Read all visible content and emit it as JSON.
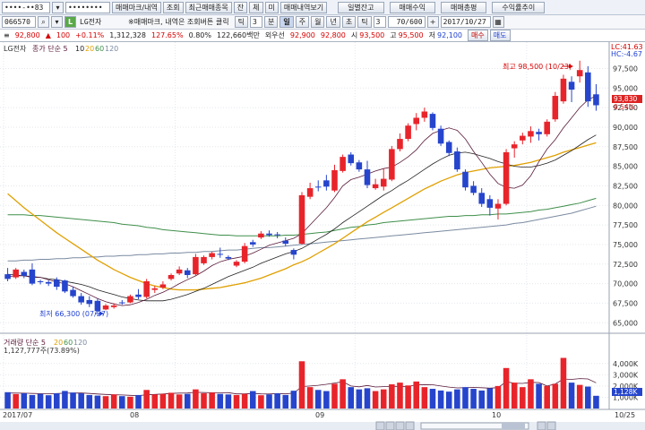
{
  "toolbar1": {
    "account_id": "••••-••83",
    "password_mask": "••••••••",
    "btn_order_history": "매매마크/내역",
    "btn_inquiry": "조회",
    "btn_recent_items": "최근매매종목",
    "btn_jan": "잔",
    "btn_che": "체",
    "btn_mi": "미",
    "btn_trade_history_view": "매매내역보기",
    "btn_daily_balance": "일별잔고",
    "btn_trade_return": "매매수익",
    "btn_trade_amount": "매매총평",
    "btn_return_trend": "수익률추이"
  },
  "toolbar2": {
    "stock_code": "066570",
    "stock_name": "LG전자",
    "notice": "※매매마크, 내역은 조회버튼 클릭",
    "period_tabs": [
      "틱",
      "분",
      "일",
      "주",
      "월",
      "년",
      "초",
      "틱"
    ],
    "active_tab": "일",
    "minute_value": "3",
    "count_value": "3",
    "count_range": "70/600",
    "date_value": "2017/10/27"
  },
  "infobar": {
    "price": "92,800",
    "change": "100",
    "change_pct": "+0.11%",
    "volume": "1,312,328",
    "vol_ratio": "127.65%",
    "turnover": "0.80%",
    "trade_value": "122,660백만",
    "foreign_label": "외우선",
    "ask1": "92,900",
    "bid1": "92,800",
    "open_label": "시",
    "open": "93,500",
    "high_label": "고",
    "high": "95,500",
    "low_label": "저",
    "low": "92,100",
    "buy_button": "매수",
    "sell_button": "매도"
  },
  "price_panel": {
    "legend_title": "LG전자",
    "legend_ma": "종가 단순 5",
    "ma_periods": [
      "10",
      "20",
      "60",
      "120"
    ],
    "lc_label": "LC:41.63",
    "hc_label": "HC:-4.67",
    "high_annotation": "최고 98,500 (10/23)",
    "low_annotation": "최저 66,300 (07/27)",
    "current_price_box": "93,830",
    "current_pct_box": "0.54%"
  },
  "volume_panel": {
    "legend_title": "거래량 단순 5",
    "ma_periods": [
      "20",
      "60",
      "120"
    ],
    "legend_value": "1,127,777주(73.89%)",
    "current_box": "1,128K"
  },
  "x_axis": {
    "labels": [
      "2017/07",
      "08",
      "09",
      "10",
      "10/25"
    ]
  },
  "colors": {
    "up": "#e8242b",
    "down": "#2645cc",
    "ma5": "#5a1a3a",
    "ma10": "#222222",
    "ma20": "#e0a000",
    "ma60": "#3f8f4a",
    "ma120": "#7a8aa0"
  },
  "chart_data": {
    "type": "candlestick",
    "price_ticks": [
      "97,500",
      "95,000",
      "92,500",
      "90,000",
      "87,500",
      "85,000",
      "82,500",
      "80,000",
      "77,500",
      "75,000",
      "72,500",
      "70,000",
      "67,500",
      "65,000"
    ],
    "volume_ticks": [
      "4,000K",
      "3,000K",
      "2,000K",
      "1,000K"
    ],
    "price_range": [
      64000,
      99500
    ],
    "volume_range": [
      0,
      4700
    ],
    "candles": [
      {
        "o": 71200,
        "h": 72000,
        "l": 70300,
        "c": 70600
      },
      {
        "o": 70800,
        "h": 72000,
        "l": 70600,
        "c": 71800
      },
      {
        "o": 71500,
        "h": 71800,
        "l": 70700,
        "c": 71000
      },
      {
        "o": 71800,
        "h": 72600,
        "l": 69800,
        "c": 70000
      },
      {
        "o": 70300,
        "h": 70500,
        "l": 69900,
        "c": 70200
      },
      {
        "o": 70200,
        "h": 70400,
        "l": 69700,
        "c": 70000
      },
      {
        "o": 70500,
        "h": 70800,
        "l": 69200,
        "c": 69600
      },
      {
        "o": 70400,
        "h": 70500,
        "l": 68800,
        "c": 69000
      },
      {
        "o": 69200,
        "h": 69600,
        "l": 68200,
        "c": 68400
      },
      {
        "o": 68400,
        "h": 68800,
        "l": 67300,
        "c": 67600
      },
      {
        "o": 67900,
        "h": 68400,
        "l": 67000,
        "c": 67400
      },
      {
        "o": 67800,
        "h": 68100,
        "l": 66300,
        "c": 66500
      },
      {
        "o": 66700,
        "h": 67400,
        "l": 66600,
        "c": 67200
      },
      {
        "o": 67000,
        "h": 67500,
        "l": 66800,
        "c": 67200
      },
      {
        "o": 67600,
        "h": 67900,
        "l": 67300,
        "c": 67500
      },
      {
        "o": 67600,
        "h": 68600,
        "l": 67500,
        "c": 68400
      },
      {
        "o": 68600,
        "h": 69300,
        "l": 68000,
        "c": 68300
      },
      {
        "o": 68300,
        "h": 70600,
        "l": 68100,
        "c": 70300
      },
      {
        "o": 69200,
        "h": 69700,
        "l": 68800,
        "c": 69400
      },
      {
        "o": 69500,
        "h": 70300,
        "l": 69300,
        "c": 69900
      },
      {
        "o": 70600,
        "h": 71300,
        "l": 70400,
        "c": 71100
      },
      {
        "o": 71300,
        "h": 72200,
        "l": 71100,
        "c": 71800
      },
      {
        "o": 71700,
        "h": 72000,
        "l": 70700,
        "c": 71100
      },
      {
        "o": 71200,
        "h": 73800,
        "l": 71000,
        "c": 73400
      },
      {
        "o": 72600,
        "h": 73600,
        "l": 72400,
        "c": 73400
      },
      {
        "o": 73400,
        "h": 74100,
        "l": 73100,
        "c": 73900
      },
      {
        "o": 73800,
        "h": 74600,
        "l": 73300,
        "c": 73700
      },
      {
        "o": 73400,
        "h": 73600,
        "l": 73000,
        "c": 73200
      },
      {
        "o": 72300,
        "h": 73000,
        "l": 72100,
        "c": 72800
      },
      {
        "o": 72800,
        "h": 75200,
        "l": 72600,
        "c": 74800
      },
      {
        "o": 75300,
        "h": 75600,
        "l": 74700,
        "c": 75000
      },
      {
        "o": 75900,
        "h": 76700,
        "l": 75700,
        "c": 76400
      },
      {
        "o": 76400,
        "h": 76800,
        "l": 76000,
        "c": 76200
      },
      {
        "o": 76300,
        "h": 76600,
        "l": 75800,
        "c": 76200
      },
      {
        "o": 75500,
        "h": 75900,
        "l": 74800,
        "c": 75100
      },
      {
        "o": 74300,
        "h": 74500,
        "l": 73100,
        "c": 73700
      },
      {
        "o": 75100,
        "h": 81700,
        "l": 75000,
        "c": 81300
      },
      {
        "o": 81100,
        "h": 82900,
        "l": 80800,
        "c": 82200
      },
      {
        "o": 82400,
        "h": 83200,
        "l": 81800,
        "c": 82300
      },
      {
        "o": 83200,
        "h": 83900,
        "l": 81900,
        "c": 82400
      },
      {
        "o": 81900,
        "h": 85200,
        "l": 81700,
        "c": 84500
      },
      {
        "o": 84400,
        "h": 86500,
        "l": 84200,
        "c": 86200
      },
      {
        "o": 86500,
        "h": 86800,
        "l": 85100,
        "c": 85400
      },
      {
        "o": 85500,
        "h": 85800,
        "l": 84300,
        "c": 84600
      },
      {
        "o": 84600,
        "h": 85700,
        "l": 82200,
        "c": 82600
      },
      {
        "o": 82200,
        "h": 83400,
        "l": 82000,
        "c": 82700
      },
      {
        "o": 82400,
        "h": 84700,
        "l": 81900,
        "c": 83400
      },
      {
        "o": 83300,
        "h": 87600,
        "l": 83100,
        "c": 87200
      },
      {
        "o": 87200,
        "h": 89200,
        "l": 86900,
        "c": 88500
      },
      {
        "o": 88500,
        "h": 90500,
        "l": 88200,
        "c": 90200
      },
      {
        "o": 90400,
        "h": 91800,
        "l": 89600,
        "c": 91200
      },
      {
        "o": 91200,
        "h": 92500,
        "l": 90700,
        "c": 92000
      },
      {
        "o": 91700,
        "h": 91900,
        "l": 89600,
        "c": 89900
      },
      {
        "o": 89800,
        "h": 90200,
        "l": 87600,
        "c": 87900
      },
      {
        "o": 88100,
        "h": 88300,
        "l": 86300,
        "c": 86700
      },
      {
        "o": 86900,
        "h": 87400,
        "l": 84300,
        "c": 84600
      },
      {
        "o": 84300,
        "h": 84600,
        "l": 81900,
        "c": 82300
      },
      {
        "o": 82500,
        "h": 83100,
        "l": 81300,
        "c": 81600
      },
      {
        "o": 81600,
        "h": 82200,
        "l": 79800,
        "c": 80200
      },
      {
        "o": 80800,
        "h": 81300,
        "l": 78700,
        "c": 79700
      },
      {
        "o": 79600,
        "h": 80800,
        "l": 78200,
        "c": 80200
      },
      {
        "o": 80200,
        "h": 87200,
        "l": 80000,
        "c": 86800
      },
      {
        "o": 87300,
        "h": 88200,
        "l": 86100,
        "c": 87800
      },
      {
        "o": 88300,
        "h": 89300,
        "l": 87800,
        "c": 88900
      },
      {
        "o": 88800,
        "h": 90100,
        "l": 88000,
        "c": 89500
      },
      {
        "o": 89400,
        "h": 89800,
        "l": 88300,
        "c": 89100
      },
      {
        "o": 89100,
        "h": 91000,
        "l": 88800,
        "c": 90700
      },
      {
        "o": 91000,
        "h": 94500,
        "l": 90700,
        "c": 94000
      },
      {
        "o": 93300,
        "h": 96700,
        "l": 93000,
        "c": 96200
      },
      {
        "o": 95800,
        "h": 96500,
        "l": 93200,
        "c": 94800
      },
      {
        "o": 96500,
        "h": 98500,
        "l": 95700,
        "c": 97300
      },
      {
        "o": 97000,
        "h": 97800,
        "l": 92600,
        "c": 93300
      },
      {
        "o": 94200,
        "h": 95500,
        "l": 92100,
        "c": 92800
      }
    ],
    "volume": [
      1450,
      1280,
      1350,
      1200,
      1300,
      1180,
      1350,
      1560,
      1420,
      1350,
      1200,
      1150,
      1100,
      1250,
      1100,
      1050,
      1200,
      1650,
      1250,
      1300,
      1400,
      1250,
      1300,
      1700,
      1350,
      1420,
      1300,
      1250,
      1200,
      1300,
      1550,
      1180,
      1250,
      1350,
      1200,
      1580,
      4200,
      1900,
      1650,
      1550,
      2200,
      2600,
      1900,
      1700,
      1800,
      1550,
      1700,
      2150,
      2300,
      2050,
      2400,
      1900,
      1750,
      1600,
      1500,
      1700,
      1900,
      1750,
      1600,
      1800,
      2000,
      3600,
      2300,
      1900,
      2600,
      2200,
      2000,
      2200,
      4500,
      2300,
      2100,
      1950,
      1130
    ],
    "ma5": [
      70900,
      71000,
      71000,
      70800,
      70800,
      70500,
      70200,
      70000,
      69600,
      69100,
      68600,
      68100,
      67700,
      67400,
      67200,
      67300,
      67600,
      68000,
      68500,
      68900,
      69400,
      70000,
      70500,
      71000,
      71600,
      72300,
      72800,
      73100,
      73300,
      73500,
      73900,
      74400,
      74900,
      75200,
      75500,
      75800,
      76400,
      77500,
      78600,
      79700,
      81000,
      82500,
      83300,
      83600,
      84000,
      84400,
      84700,
      84900,
      85500,
      86200,
      87100,
      88300,
      89200,
      89600,
      89900,
      89600,
      88500,
      86900,
      85500,
      84000,
      82800,
      82300,
      82200,
      82600,
      83800,
      85600,
      87200,
      88400,
      89900,
      91200,
      92500,
      93500,
      94000
    ],
    "ma10": [
      71200,
      71100,
      71000,
      70900,
      70800,
      70600,
      70500,
      70300,
      70100,
      69900,
      69600,
      69200,
      68900,
      68600,
      68300,
      68100,
      67900,
      67800,
      67800,
      67800,
      68000,
      68300,
      68600,
      69000,
      69400,
      69900,
      70400,
      70900,
      71300,
      71700,
      72100,
      72600,
      73000,
      73400,
      73800,
      74100,
      74500,
      75100,
      75700,
      76300,
      77000,
      77800,
      78500,
      79200,
      79900,
      80600,
      81300,
      81900,
      82600,
      83200,
      83900,
      84600,
      85300,
      85900,
      86400,
      86700,
      86800,
      86600,
      86300,
      86000,
      85600,
      85300,
      85000,
      84900,
      84900,
      85100,
      85400,
      85800,
      86400,
      87000,
      87700,
      88400,
      89000
    ],
    "ma20": [
      81500,
      80600,
      79700,
      78900,
      78100,
      77300,
      76500,
      75800,
      75100,
      74400,
      73700,
      73000,
      72400,
      71800,
      71300,
      70800,
      70400,
      70000,
      69700,
      69500,
      69300,
      69200,
      69200,
      69200,
      69300,
      69400,
      69500,
      69700,
      69900,
      70100,
      70400,
      70700,
      71100,
      71500,
      71900,
      72400,
      72800,
      73300,
      73900,
      74500,
      75100,
      75800,
      76500,
      77200,
      77900,
      78500,
      79100,
      79700,
      80300,
      80900,
      81500,
      82100,
      82600,
      83100,
      83500,
      83900,
      84200,
      84400,
      84600,
      84800,
      84900,
      85000,
      85100,
      85300,
      85500,
      85800,
      86100,
      86400,
      86800,
      87100,
      87400,
      87700,
      88000
    ],
    "ma60": [
      78800,
      78800,
      78800,
      78700,
      78700,
      78600,
      78500,
      78400,
      78300,
      78200,
      78100,
      78000,
      77900,
      77800,
      77600,
      77500,
      77400,
      77200,
      77100,
      76900,
      76800,
      76700,
      76600,
      76500,
      76400,
      76300,
      76200,
      76200,
      76100,
      76100,
      76100,
      76100,
      76100,
      76100,
      76200,
      76200,
      76300,
      76400,
      76500,
      76600,
      76800,
      77000,
      77200,
      77300,
      77500,
      77600,
      77800,
      77900,
      78000,
      78100,
      78200,
      78300,
      78400,
      78500,
      78600,
      78600,
      78700,
      78700,
      78800,
      78800,
      78900,
      78900,
      79000,
      79100,
      79200,
      79400,
      79500,
      79700,
      79900,
      80100,
      80300,
      80600,
      80900
    ],
    "ma120": [
      72900,
      72900,
      73000,
      73000,
      73100,
      73100,
      73200,
      73200,
      73300,
      73300,
      73400,
      73400,
      73500,
      73500,
      73600,
      73600,
      73700,
      73700,
      73800,
      73800,
      73900,
      73900,
      74000,
      74000,
      74100,
      74100,
      74200,
      74300,
      74300,
      74400,
      74500,
      74600,
      74600,
      74700,
      74800,
      74900,
      75000,
      75100,
      75200,
      75300,
      75400,
      75500,
      75600,
      75700,
      75800,
      75900,
      76000,
      76100,
      76200,
      76300,
      76400,
      76500,
      76600,
      76700,
      76800,
      76900,
      77000,
      77100,
      77200,
      77300,
      77400,
      77500,
      77700,
      77800,
      78000,
      78200,
      78400,
      78600,
      78800,
      79000,
      79300,
      79600,
      79900
    ],
    "vol_ma": [
      1380,
      1370,
      1360,
      1340,
      1320,
      1310,
      1330,
      1360,
      1370,
      1380,
      1340,
      1290,
      1250,
      1220,
      1200,
      1170,
      1150,
      1220,
      1250,
      1290,
      1340,
      1370,
      1380,
      1440,
      1420,
      1400,
      1400,
      1410,
      1300,
      1300,
      1340,
      1300,
      1290,
      1330,
      1300,
      1370,
      1950,
      2000,
      2060,
      2150,
      2260,
      2380,
      2000,
      1930,
      2050,
      1910,
      1940,
      1960,
      1970,
      1950,
      2110,
      2130,
      2110,
      2000,
      1900,
      1830,
      1850,
      1870,
      1850,
      1810,
      1860,
      2380,
      2250,
      2230,
      2330,
      2310,
      2000,
      2180,
      2620,
      2590,
      2660,
      2630,
      2290
    ]
  }
}
